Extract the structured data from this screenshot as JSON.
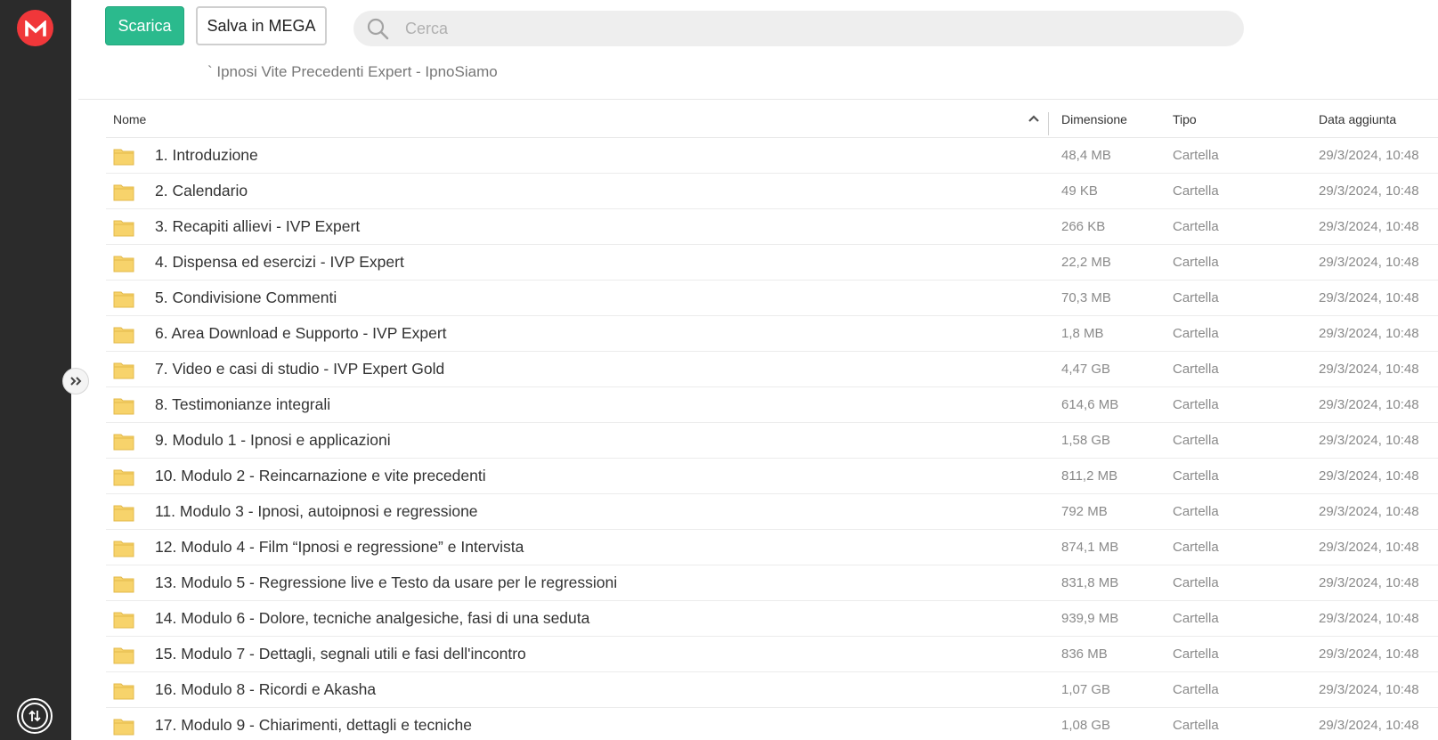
{
  "header": {
    "download_label": "Scarica",
    "save_label": "Salva in MEGA",
    "search_placeholder": "Cerca",
    "breadcrumb": "` Ipnosi Vite Precedenti Expert - IpnoSiamo"
  },
  "colors": {
    "accent_green": "#2bba8d",
    "mega_red": "#f0373a",
    "rail_bg": "#2b2b2b",
    "folder_yellow": "#f7d36b"
  },
  "icons": {
    "logo": "mega-logo-icon",
    "search": "search-icon",
    "expand": "chevron-double-right-icon",
    "transfers": "transfer-arrows-icon",
    "sort": "chevron-up-icon",
    "folder": "folder-icon"
  },
  "table": {
    "columns": {
      "name": "Nome",
      "size": "Dimensione",
      "type": "Tipo",
      "date": "Data aggiunta"
    },
    "rows": [
      {
        "name": "1. Introduzione",
        "size": "48,4 MB",
        "type": "Cartella",
        "date": "29/3/2024, 10:48"
      },
      {
        "name": "2. Calendario",
        "size": "49 KB",
        "type": "Cartella",
        "date": "29/3/2024, 10:48"
      },
      {
        "name": "3. Recapiti allievi - IVP Expert",
        "size": "266 KB",
        "type": "Cartella",
        "date": "29/3/2024, 10:48"
      },
      {
        "name": "4. Dispensa ed esercizi - IVP Expert",
        "size": "22,2 MB",
        "type": "Cartella",
        "date": "29/3/2024, 10:48"
      },
      {
        "name": "5. Condivisione Commenti",
        "size": "70,3 MB",
        "type": "Cartella",
        "date": "29/3/2024, 10:48"
      },
      {
        "name": "6. Area Download e Supporto - IVP Expert",
        "size": "1,8 MB",
        "type": "Cartella",
        "date": "29/3/2024, 10:48"
      },
      {
        "name": "7. Video e casi di studio - IVP Expert Gold",
        "size": "4,47 GB",
        "type": "Cartella",
        "date": "29/3/2024, 10:48"
      },
      {
        "name": "8. Testimonianze integrali",
        "size": "614,6 MB",
        "type": "Cartella",
        "date": "29/3/2024, 10:48"
      },
      {
        "name": "9. Modulo 1 - Ipnosi e applicazioni",
        "size": "1,58 GB",
        "type": "Cartella",
        "date": "29/3/2024, 10:48"
      },
      {
        "name": "10. Modulo 2 - Reincarnazione e vite precedenti",
        "size": "811,2 MB",
        "type": "Cartella",
        "date": "29/3/2024, 10:48"
      },
      {
        "name": "11. Modulo 3 - Ipnosi, autoipnosi e regressione",
        "size": "792 MB",
        "type": "Cartella",
        "date": "29/3/2024, 10:48"
      },
      {
        "name": "12. Modulo 4 - Film “Ipnosi e regressione” e Intervista",
        "size": "874,1 MB",
        "type": "Cartella",
        "date": "29/3/2024, 10:48"
      },
      {
        "name": "13. Modulo 5 - Regressione live e Testo da usare per le regressioni",
        "size": "831,8 MB",
        "type": "Cartella",
        "date": "29/3/2024, 10:48"
      },
      {
        "name": "14. Modulo 6 - Dolore, tecniche analgesiche, fasi di una seduta",
        "size": "939,9 MB",
        "type": "Cartella",
        "date": "29/3/2024, 10:48"
      },
      {
        "name": "15. Modulo 7 - Dettagli, segnali utili e fasi dell'incontro",
        "size": "836 MB",
        "type": "Cartella",
        "date": "29/3/2024, 10:48"
      },
      {
        "name": "16. Modulo 8 - Ricordi e Akasha",
        "size": "1,07 GB",
        "type": "Cartella",
        "date": "29/3/2024, 10:48"
      },
      {
        "name": "17. Modulo 9 - Chiarimenti, dettagli e tecniche",
        "size": "1,08 GB",
        "type": "Cartella",
        "date": "29/3/2024, 10:48"
      }
    ]
  }
}
